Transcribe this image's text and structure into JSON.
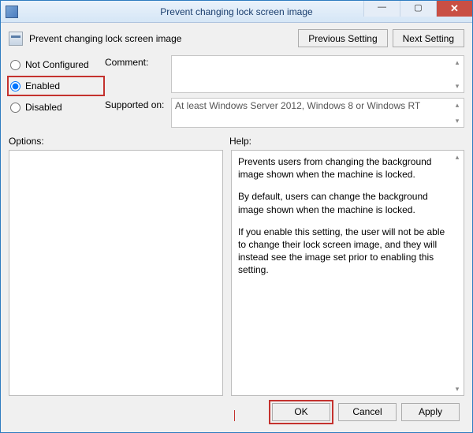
{
  "window": {
    "title": "Prevent changing lock screen image",
    "controls": {
      "min_glyph": "—",
      "max_glyph": "▢",
      "close_glyph": "✕"
    }
  },
  "header": {
    "policy_title": "Prevent changing lock screen image",
    "previous_label": "Previous Setting",
    "next_label": "Next Setting"
  },
  "state": {
    "not_configured_label": "Not Configured",
    "enabled_label": "Enabled",
    "disabled_label": "Disabled",
    "selected": "enabled"
  },
  "fields": {
    "comment_label": "Comment:",
    "comment_value": "",
    "supported_label": "Supported on:",
    "supported_value": "At least Windows Server 2012, Windows 8 or Windows RT"
  },
  "panes": {
    "options_label": "Options:",
    "help_label": "Help:",
    "help_p1": "Prevents users from changing the background image shown when the machine is locked.",
    "help_p2": "By default, users can change the background image shown when the machine is locked.",
    "help_p3": "If you enable this setting, the user will not be able to change their lock screen image, and they will instead see the image set prior to enabling this setting."
  },
  "footer": {
    "ok_label": "OK",
    "cancel_label": "Cancel",
    "apply_label": "Apply"
  }
}
